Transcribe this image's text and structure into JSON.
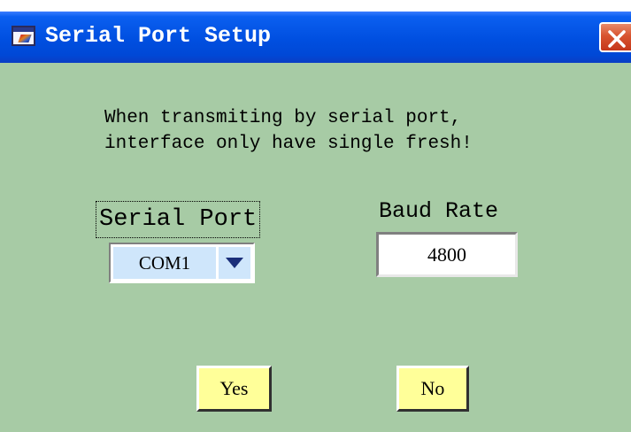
{
  "window": {
    "title": "Serial Port Setup",
    "icon": "labview-vi-icon",
    "close_icon": "close-x-icon",
    "background_color": "#a7cba5",
    "titlebar_color": "#0052e0",
    "close_button_color": "#d8532f"
  },
  "message": {
    "text": "When transmiting by serial port,\ninterface only have single fresh!"
  },
  "serial_port": {
    "label": "Serial Port",
    "selected_value": "COM1",
    "dropdown_icon": "triangle-down-icon"
  },
  "baud_rate": {
    "label": "Baud Rate",
    "value": "4800"
  },
  "buttons": {
    "yes_label": "Yes",
    "no_label": "No",
    "button_color": "#ffff99"
  }
}
